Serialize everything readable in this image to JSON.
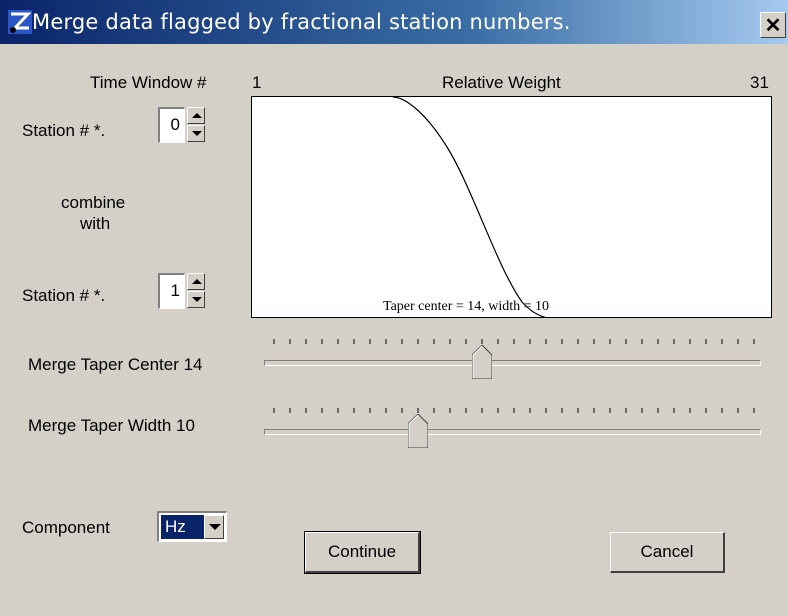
{
  "window": {
    "title": "Merge data flagged by fractional station numbers."
  },
  "header": {
    "time_window_label": "Time Window #",
    "range_start": "1",
    "relative_weight_label": "Relative Weight",
    "range_end": "31"
  },
  "station1": {
    "label": "Station #  *.",
    "value": "0"
  },
  "combine_label_line1": "combine",
  "combine_label_line2": "with",
  "station2": {
    "label": "Station #  *.",
    "value": "1"
  },
  "plot": {
    "caption": "Taper center = 14, width = 10"
  },
  "taper_center": {
    "label": "Merge Taper Center 14",
    "value": 14,
    "min": 1,
    "max": 31
  },
  "taper_width": {
    "label": "Merge Taper Width 10",
    "value": 10,
    "min": 1,
    "max": 31
  },
  "component": {
    "label": "Component",
    "selected": "Hz"
  },
  "buttons": {
    "continue": "Continue",
    "cancel": "Cancel"
  },
  "colors": {
    "title_start": "#0a246a",
    "title_end": "#a6caf0",
    "face": "#d4d0c8"
  }
}
